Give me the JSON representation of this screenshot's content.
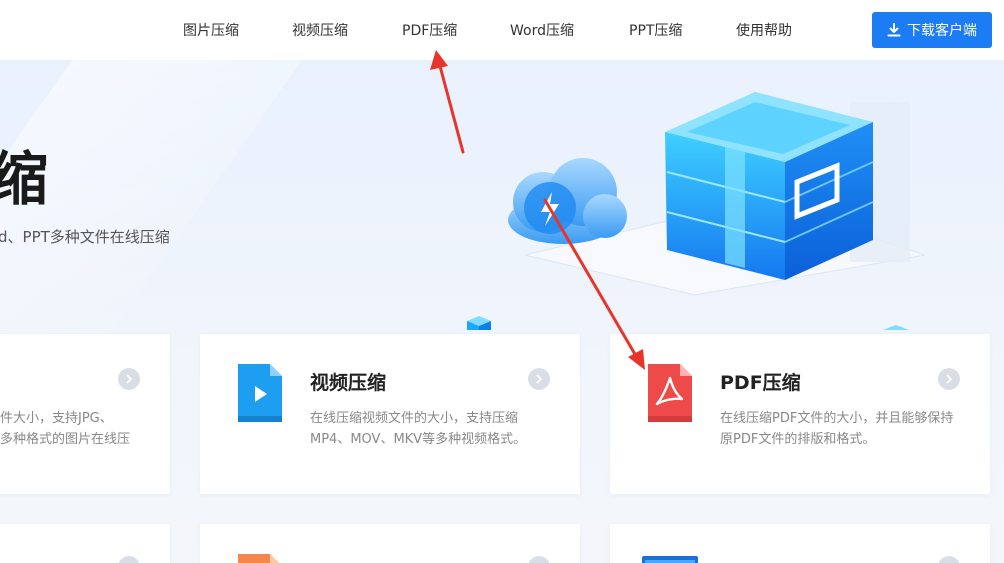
{
  "nav": {
    "items": [
      "图片压缩",
      "视频压缩",
      "PDF压缩",
      "Word压缩",
      "PPT压缩",
      "使用帮助"
    ],
    "download_label": "下载客户端"
  },
  "hero": {
    "title_fragment": "缩",
    "subtitle_fragment": "d、PPT多种文件在线压缩"
  },
  "cards": {
    "image": {
      "desc_line1": "件大小，支持JPG、",
      "desc_line2": "多种格式的图片在线压"
    },
    "video": {
      "title": "视频压缩",
      "desc": "在线压缩视频文件的大小，支持压缩MP4、MOV、MKV等多种视频格式。"
    },
    "pdf": {
      "title": "PDF压缩",
      "desc": "在线压缩PDF文件的大小，并且能够保持原PDF文件的排版和格式。"
    }
  },
  "colors": {
    "accent": "#1b7cf4",
    "annotation_arrow": "#e8352c",
    "video_icon": "#1e9ef0",
    "pdf_icon": "#ef4a4a",
    "ppt_icon": "#f5874a"
  }
}
